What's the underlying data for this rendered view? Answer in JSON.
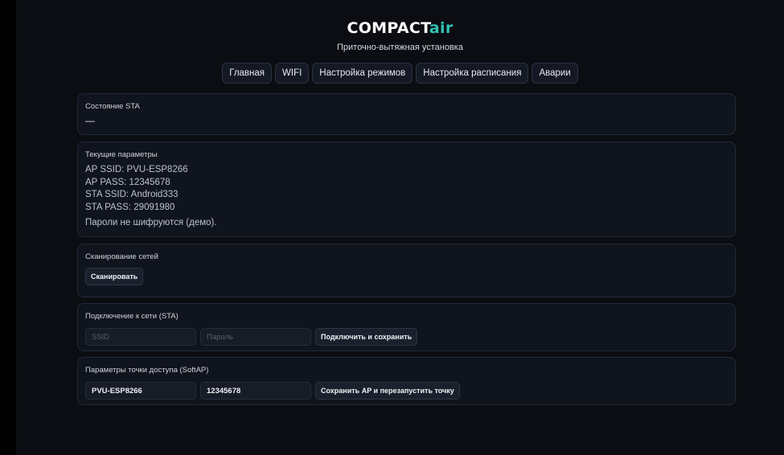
{
  "header": {
    "logo_main": "COMPACT",
    "logo_accent": "air",
    "subtitle": "Приточно-вытяжная установка"
  },
  "nav": {
    "items": [
      {
        "label": "Главная"
      },
      {
        "label": "WIFI"
      },
      {
        "label": "Настройка режимов"
      },
      {
        "label": "Настройка расписания"
      },
      {
        "label": "Аварии"
      }
    ]
  },
  "sta_state": {
    "title": "Состояние STA",
    "value": "—"
  },
  "current_params": {
    "title": "Текущие параметры",
    "ap_ssid": "AP SSID: PVU-ESP8266",
    "ap_pass": "AP PASS: 12345678",
    "sta_ssid": "STA SSID: Android333",
    "sta_pass": "STA PASS: 29091980",
    "note": "Пароли не шифруются (демо)."
  },
  "scan": {
    "title": "Сканирование сетей",
    "button_label": "Сканировать"
  },
  "sta_connect": {
    "title": "Подключение к сети (STA)",
    "ssid_placeholder": "SSID",
    "ssid_value": "",
    "password_placeholder": "Пароль",
    "password_value": "",
    "button_label": "Подключить и сохранить"
  },
  "softap": {
    "title": "Параметры точки доступа (SoftAP)",
    "ssid_value": "PVU-ESP8266",
    "password_value": "12345678",
    "button_label": "Сохранить AP и перезапустить точку"
  },
  "colors": {
    "accent": "#31c2b3",
    "background": "#0b0d12",
    "card": "#10141d"
  }
}
